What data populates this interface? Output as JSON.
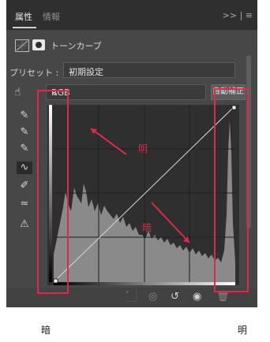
{
  "tabs": [
    {
      "label": "属性",
      "active": true
    },
    {
      "label": "情報",
      "active": false
    }
  ],
  "tab_menu_glyph": ">> | ≡",
  "header": {
    "title": "トーンカーブ"
  },
  "preset": {
    "label": "プリセット :",
    "value": "初期設定"
  },
  "channel": {
    "value": "RGB"
  },
  "auto_button": "自動補正",
  "annotations": {
    "bright": "明",
    "dark": "暗"
  },
  "captions": {
    "left": "暗",
    "right": "明"
  },
  "colors": {
    "panel": "#474747",
    "annotation": "#e0284f",
    "histogram": "#8a8a8a"
  }
}
